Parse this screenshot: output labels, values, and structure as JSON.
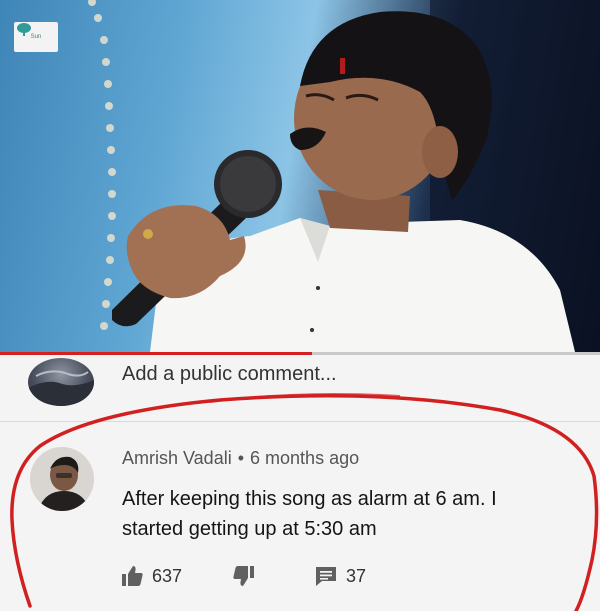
{
  "channel_logo": {
    "text": "Sun"
  },
  "video": {
    "progress": 0.52
  },
  "add_comment": {
    "placeholder": "Add a public comment..."
  },
  "comment": {
    "author": "Amrish Vadali",
    "separator": "•",
    "time": "6 months ago",
    "text": "After keeping this song as alarm at 6 am. I started getting up at 5:30 am",
    "likes": "637",
    "replies": "37"
  },
  "icons": {
    "like": "thumbs-up-icon",
    "dislike": "thumbs-down-icon",
    "reply": "comment-icon"
  },
  "colors": {
    "annotation": "#d22020",
    "progress": "#d42020",
    "background": "#f4f4f4"
  }
}
